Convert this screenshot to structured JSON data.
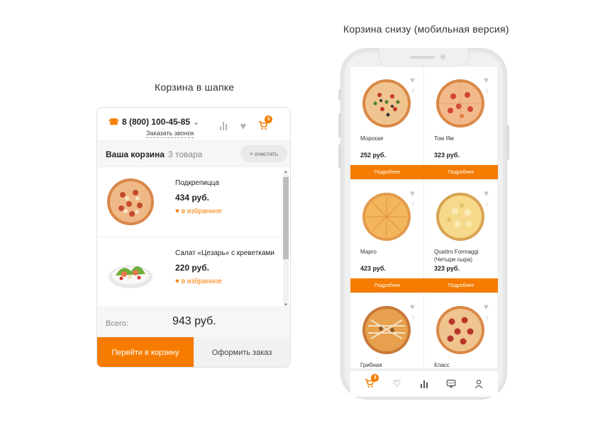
{
  "captions": {
    "left": "Корзина в шапке",
    "right": "Корзина снизу (мобильная версия)"
  },
  "header_widget": {
    "phone": "8 (800) 100-45-85",
    "callback": "Заказать звонок",
    "cart_badge": "3",
    "cart_title": "Ваша корзина",
    "cart_count": "3 товара",
    "clear_label": "× очистить",
    "items": [
      {
        "name": "Подкрепицца",
        "price": "434 руб.",
        "fav": "в избранное"
      },
      {
        "name": "Салат «Цезарь» с креветками",
        "price": "220 руб.",
        "fav": "в избранное"
      }
    ],
    "total_label": "Всего:",
    "total_value": "943 руб.",
    "go_to_cart": "Перейти в корзину",
    "checkout": "Оформить заказ"
  },
  "mobile": {
    "products": [
      {
        "name": "Морская",
        "price": "252 руб.",
        "more": "Подробнее"
      },
      {
        "name": "Том Ям",
        "price": "323 руб.",
        "more": "Подробнее"
      },
      {
        "name": "Марго",
        "price": "423 руб.",
        "more": "Подробнее"
      },
      {
        "name": "Quattro Formaggi (Четыре сыра)",
        "price": "323 руб.",
        "more": "Подробнее"
      },
      {
        "name": "Грибная",
        "price": "",
        "more": ""
      },
      {
        "name": "Класс",
        "price": "",
        "more": ""
      }
    ],
    "tab_cart_badge": "3"
  },
  "colors": {
    "accent": "#f57c00"
  },
  "icons": [
    "phone-icon",
    "chevron-down-icon",
    "stats-icon",
    "heart-icon",
    "cart-icon",
    "user-icon",
    "chat-icon"
  ]
}
